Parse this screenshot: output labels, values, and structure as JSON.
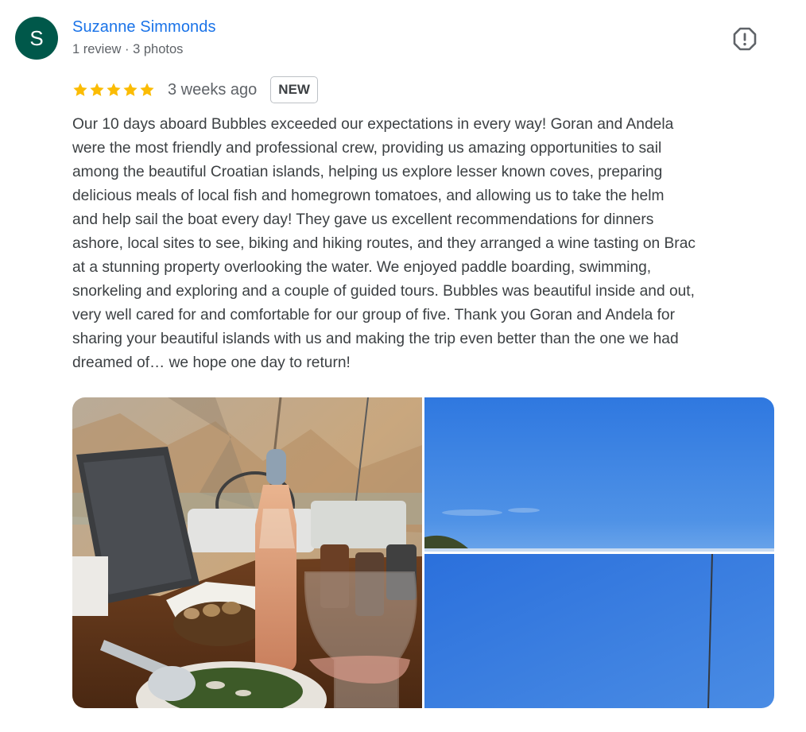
{
  "reviewer": {
    "initial": "S",
    "name": "Suzanne Simmonds",
    "meta": "1 review · 3 photos",
    "avatar_color": "#00584a"
  },
  "review": {
    "rating": 5,
    "date": "3 weeks ago",
    "badge": "NEW",
    "text": "Our 10 days aboard Bubbles exceeded our expectations in every way! Goran and Andela\nwere the most friendly and professional crew, providing us amazing opportunities to sail\namong the beautiful Croatian islands, helping us explore lesser known coves, preparing\ndelicious meals of local fish and homegrown tomatoes, and allowing us to take the helm\nand help sail the boat every day! They gave us excellent recommendations for dinners\nashore, local sites to see, biking and hiking routes, and they arranged a wine tasting on Brac\nat a stunning property overlooking the water. We enjoyed paddle boarding, swimming,\nsnorkeling and exploring and a couple of guided tours. Bubbles was beautiful inside and out,\nvery well cared for and comfortable for our group of five. Thank you Goran and Andela for\nsharing your beautiful islands with us and making the trip even better than the one we had\ndreamed of… we hope one day to return!"
  },
  "icons": {
    "report": "report-flag-icon",
    "star": "star-icon"
  },
  "colors": {
    "name_link": "#1a73e8",
    "star": "#fbbc04",
    "secondary_text": "#5f6368",
    "body_text": "#3c4043"
  }
}
